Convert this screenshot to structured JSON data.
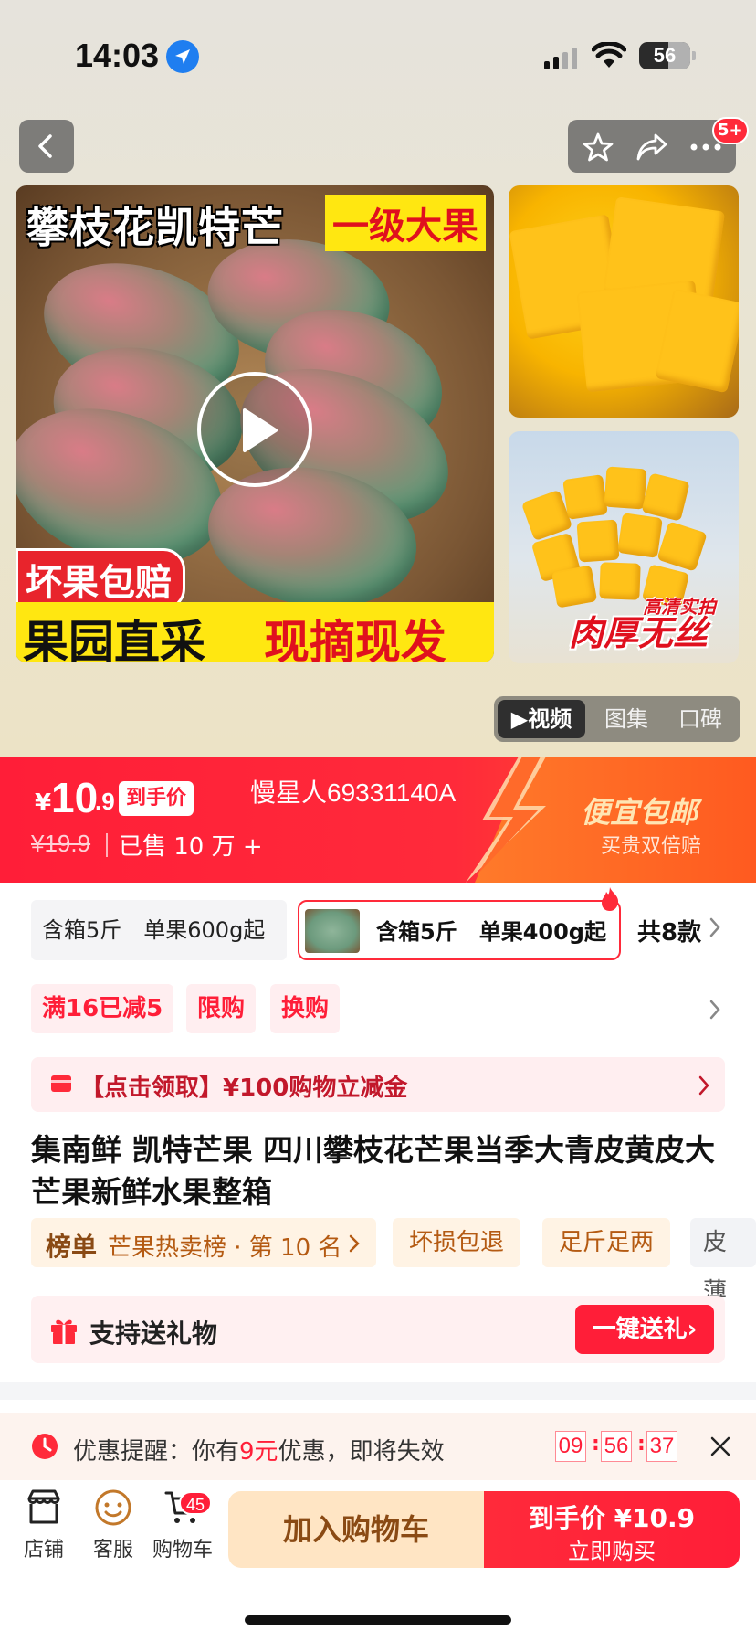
{
  "status_bar": {
    "time": "14:03",
    "battery": "56"
  },
  "nav": {
    "more_badge": "5+"
  },
  "gallery": {
    "main_title": "攀枝花凯特芒",
    "main_grade": "一级大果",
    "main_compensate": "坏果包赔",
    "main_bottom_left": "果园直采",
    "main_bottom_right": "现摘现发",
    "side_caption_small": "高清实拍",
    "side_caption": "肉厚无丝",
    "tabs": [
      "▶视频",
      "图集",
      "口碑"
    ]
  },
  "price": {
    "symbol": "¥",
    "integer": "10",
    "decimal": ".9",
    "tag": "到手价",
    "original": "¥19.9",
    "sold": "已售 10 万 +",
    "code": "慢星人69331140A",
    "promo_main": "便宜包邮",
    "promo_sub": "买贵双倍赔"
  },
  "specs": {
    "option_a": "含箱5斤　单果600g起",
    "option_b": "含箱5斤　单果400g起",
    "count": "共8款"
  },
  "promos": [
    "满16已减5",
    "限购",
    "换购"
  ],
  "coupon": {
    "text": "【点击领取】¥100购物立减金"
  },
  "product": {
    "title": "集南鲜 凯特芒果 四川攀枝花芒果当季大青皮黄皮大芒果新鲜水果整箱"
  },
  "rank": {
    "label": "榜单",
    "value": "芒果热卖榜 · 第 10 名"
  },
  "tags": [
    "坏损包退",
    "足斤足两",
    "皮薄"
  ],
  "gift": {
    "text": "支持送礼物",
    "button": "一键送礼"
  },
  "reminder": {
    "prefix": "优惠提醒：你有",
    "amount": "9元",
    "suffix": "优惠，即将失效",
    "hh": "09",
    "mm": "56",
    "ss": "37"
  },
  "bottom": {
    "shop": "店铺",
    "service": "客服",
    "cart": "购物车",
    "cart_badge": "45",
    "add_cart": "加入购物车",
    "buy_line1": "到手价 ¥10.9",
    "buy_line2": "立即购买"
  },
  "colors": {
    "accent": "#ff1e38",
    "warm": "#ff5a20",
    "gold": "#8a4a14"
  }
}
